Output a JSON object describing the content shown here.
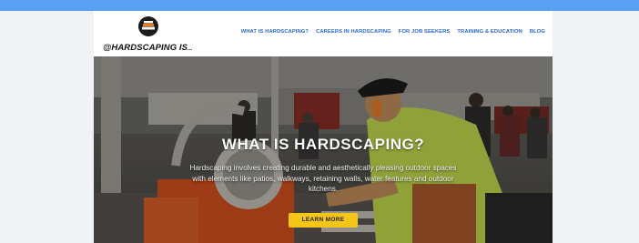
{
  "site": {
    "logo_text": "@HARDSCAPING IS",
    "logo_suffix": "...",
    "nav": [
      "WHAT IS HARDSCAPING?",
      "CAREERS IN HARDSCAPING",
      "FOR JOB SEEKERS",
      "TRAINING & EDUCATION",
      "BLOG"
    ]
  },
  "hero": {
    "title": "WHAT IS HARDSCAPING?",
    "description": "Hardscaping involves creating durable and aesthetically pleasing outdoor spaces with elements like patios, walkways, retaining walls, water features and outdoor kitchens.",
    "cta_label": "LEARN MORE"
  },
  "colors": {
    "top_strip": "#5aa0f2",
    "nav_link": "#2a67c9",
    "cta": "#f5c518",
    "page_bg": "#f1f2f4"
  },
  "icons": {
    "logo": "paver-stack-logo-icon"
  }
}
